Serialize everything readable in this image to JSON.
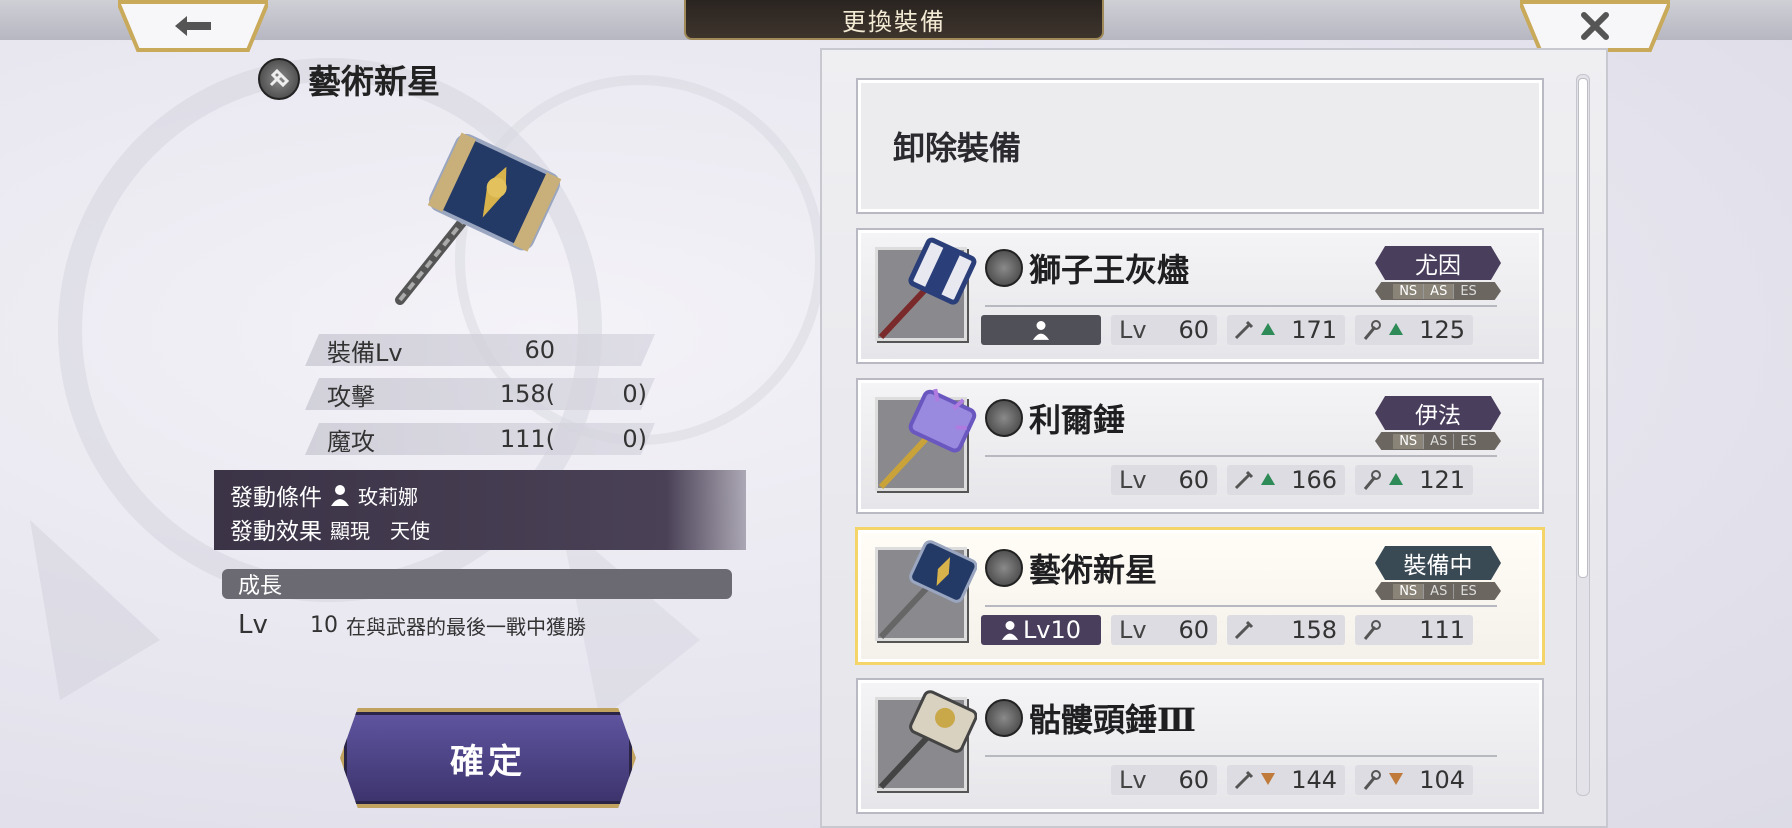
{
  "header": {
    "title": "更換裝備"
  },
  "selected": {
    "name": "藝術新星",
    "stats": [
      {
        "label": "裝備Lv",
        "value": "60",
        "paren": ""
      },
      {
        "label": "攻擊",
        "value": "158(",
        "paren": "0)"
      },
      {
        "label": "魔攻",
        "value": "111(",
        "paren": "0)"
      }
    ],
    "condition_label": "發動條件",
    "condition_value": "玫莉娜",
    "effect_label": "發動效果",
    "effect_value": "顯現　天使",
    "growth_title": "成長",
    "growth_lv_label": "Lv",
    "growth_lv": "10",
    "growth_desc": "在與武器的最後一戰中獲勝",
    "confirm_label": "確定"
  },
  "list": {
    "unequip_label": "卸除裝備",
    "items": [
      {
        "name": "獅子王灰燼",
        "tag": "尤因",
        "ns": "NS",
        "as": "AS",
        "es": "ES",
        "owner": "",
        "lv_label": "Lv",
        "lv": "60",
        "atk": "171",
        "atk_trend": "up",
        "mag": "125",
        "mag_trend": "up",
        "equipped": false
      },
      {
        "name": "利爾錘",
        "tag": "伊法",
        "ns": "NS",
        "as": "AS",
        "es": "ES",
        "owner": "",
        "lv_label": "Lv",
        "lv": "60",
        "atk": "166",
        "atk_trend": "up",
        "mag": "121",
        "mag_trend": "up",
        "equipped": false
      },
      {
        "name": "藝術新星",
        "tag": "裝備中",
        "ns": "NS",
        "as": "AS",
        "es": "ES",
        "owner": "Lv10",
        "lv_label": "Lv",
        "lv": "60",
        "atk": "158",
        "atk_trend": "none",
        "mag": "111",
        "mag_trend": "none",
        "equipped": true
      },
      {
        "name": "骷髏頭錘Ⅲ",
        "tag": "",
        "ns": "",
        "as": "",
        "es": "",
        "owner": "",
        "lv_label": "Lv",
        "lv": "60",
        "atk": "144",
        "atk_trend": "down",
        "mag": "104",
        "mag_trend": "down",
        "equipped": false
      }
    ]
  },
  "colors": {
    "accent": "#4a3e5d",
    "gold": "#c2a25f",
    "up": "#2e8a57",
    "down": "#c07a3a"
  }
}
